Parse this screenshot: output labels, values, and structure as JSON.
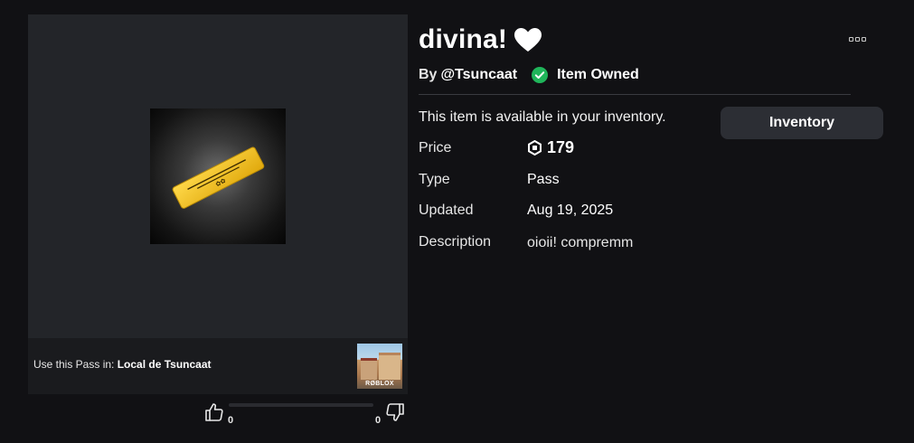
{
  "item": {
    "title": "divina!",
    "by_label": "By",
    "creator": "@Tsuncaat",
    "owned_label": "Item Owned",
    "available_text": "This item is available in your inventory.",
    "inventory_button": "Inventory"
  },
  "details": {
    "price_label": "Price",
    "price_value": "179",
    "type_label": "Type",
    "type_value": "Pass",
    "updated_label": "Updated",
    "updated_value": "Aug 19, 2025",
    "description_label": "Description",
    "description_value": "oioii! compremm"
  },
  "place": {
    "use_label": "Use this Pass in:",
    "place_name": "Local de Tsuncaat",
    "thumb_logo_text": "RØBLOX"
  },
  "votes": {
    "up_count": "0",
    "down_count": "0"
  },
  "icons": {
    "heart": "heart-icon",
    "more": "more-options-icon",
    "owned": "check-circle-icon",
    "robux": "robux-icon",
    "thumb_up": "thumbs-up-icon",
    "thumb_down": "thumbs-down-icon"
  },
  "colors": {
    "background": "#111114",
    "panel": "#232529",
    "owned_green": "#1fb55a",
    "ticket_gold": "#f2c21c",
    "button_bg": "#2c2e34"
  }
}
